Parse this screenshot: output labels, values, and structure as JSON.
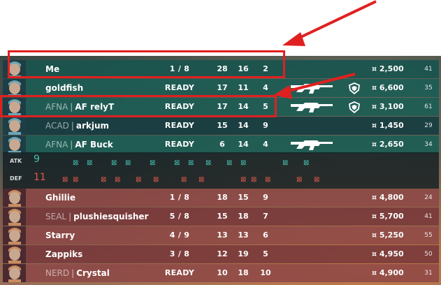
{
  "players": [
    {
      "tag": "",
      "name": "Me",
      "status": "1 / 8",
      "k": "28",
      "d": "16",
      "a": "2",
      "weapon": "",
      "shield": "",
      "credits": "¤ 2,500",
      "level": "41",
      "team": "ally"
    },
    {
      "tag": "",
      "name": "goldfish",
      "status": "READY",
      "k": "17",
      "d": "11",
      "a": "4",
      "weapon": "rifle-icon",
      "shield": "heavy-shield-icon",
      "credits": "¤ 6,600",
      "level": "35",
      "team": "ally"
    },
    {
      "tag": "AFNA",
      "name": "AF relyT",
      "status": "READY",
      "k": "17",
      "d": "14",
      "a": "5",
      "weapon": "rifle-icon",
      "shield": "heavy-shield-icon",
      "credits": "¤ 3,100",
      "level": "61",
      "team": "ally"
    },
    {
      "tag": "ACAD",
      "name": "arkjum",
      "status": "READY",
      "k": "15",
      "d": "14",
      "a": "9",
      "weapon": "",
      "shield": "",
      "credits": "¤ 1,450",
      "level": "29",
      "team": "ally"
    },
    {
      "tag": "AFNA",
      "name": "AF Buck",
      "status": "READY",
      "k": "6",
      "d": "14",
      "a": "4",
      "weapon": "rifle-icon",
      "shield": "",
      "credits": "¤ 2,650",
      "level": "34",
      "team": "ally"
    },
    {
      "tag": "",
      "name": "Ghillie",
      "status": "1 / 8",
      "k": "18",
      "d": "15",
      "a": "9",
      "weapon": "",
      "shield": "",
      "credits": "¤ 4,800",
      "level": "24",
      "team": "enemy"
    },
    {
      "tag": "SEAL",
      "name": "plushiesquisher",
      "status": "5 / 8",
      "k": "15",
      "d": "18",
      "a": "7",
      "weapon": "",
      "shield": "",
      "credits": "¤ 5,700",
      "level": "41",
      "team": "enemy"
    },
    {
      "tag": "",
      "name": "Starry",
      "status": "4 / 9",
      "k": "13",
      "d": "13",
      "a": "6",
      "weapon": "",
      "shield": "",
      "credits": "¤ 5,250",
      "level": "55",
      "team": "enemy"
    },
    {
      "tag": "",
      "name": "Zappiks",
      "status": "3 / 8",
      "k": "12",
      "d": "19",
      "a": "5",
      "weapon": "",
      "shield": "",
      "credits": "¤ 4,950",
      "level": "50",
      "team": "enemy"
    },
    {
      "tag": "NERD",
      "name": "Crystal",
      "status": "READY",
      "k": "10",
      "d": "18",
      "a": "10",
      "weapon": "",
      "shield": "",
      "credits": "¤ 4,900",
      "level": "31",
      "team": "enemy"
    }
  ],
  "timeline": {
    "atk_label": "ATK",
    "def_label": "DEF",
    "atk_score": "9",
    "def_score": "11"
  },
  "colors": {
    "ally_accent": "#47c0b0",
    "enemy_accent": "#e05a4a",
    "highlight": "#e02020"
  }
}
